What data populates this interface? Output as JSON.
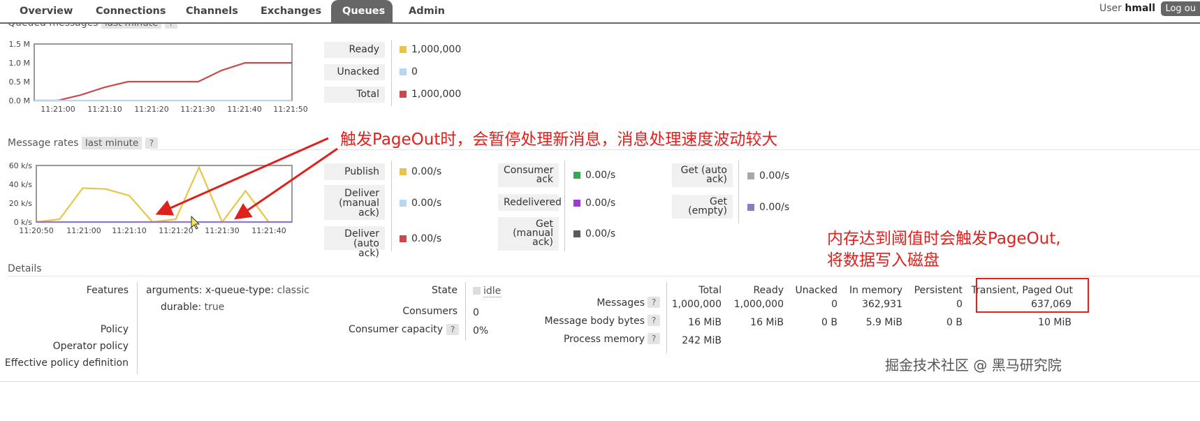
{
  "nav": {
    "tabs": [
      {
        "label": "Overview"
      },
      {
        "label": "Connections"
      },
      {
        "label": "Channels"
      },
      {
        "label": "Exchanges"
      },
      {
        "label": "Queues"
      },
      {
        "label": "Admin"
      }
    ],
    "active_tab": "Queues",
    "user_label": "User",
    "username": "hmall",
    "logout_label": "Log ou"
  },
  "queued_messages": {
    "title": "Queued messages",
    "range": "last minute",
    "help": "?",
    "legend": [
      {
        "label": "Ready",
        "value": "1,000,000",
        "color": "#e8c547"
      },
      {
        "label": "Unacked",
        "value": "0",
        "color": "#b5d7f2"
      },
      {
        "label": "Total",
        "value": "1,000,000",
        "color": "#c94a4a"
      }
    ]
  },
  "message_rates": {
    "title": "Message rates",
    "range": "last minute",
    "help": "?",
    "legend": [
      {
        "label": "Publish",
        "value": "0.00/s",
        "color": "#e8c547"
      },
      {
        "label": "Deliver (manual ack)",
        "value": "0.00/s",
        "color": "#b5d7f2"
      },
      {
        "label": "Deliver (auto ack)",
        "value": "0.00/s",
        "color": "#c94a4a"
      },
      {
        "label": "Consumer ack",
        "value": "0.00/s",
        "color": "#3aa655"
      },
      {
        "label": "Redelivered",
        "value": "0.00/s",
        "color": "#a03ad6"
      },
      {
        "label": "Get (manual ack)",
        "value": "0.00/s",
        "color": "#5a5a5a"
      },
      {
        "label": "Get (auto ack)",
        "value": "0.00/s",
        "color": "#a8a8a8"
      },
      {
        "label": "Get (empty)",
        "value": "0.00/s",
        "color": "#8a7ac8"
      }
    ]
  },
  "chart_data": [
    {
      "type": "line",
      "title": "Queued messages",
      "x": [
        "11:21:00",
        "11:21:10",
        "11:21:20",
        "11:21:30",
        "11:21:40",
        "11:21:50"
      ],
      "x_full": [
        "11:20:55",
        "11:21:00",
        "11:21:05",
        "11:21:10",
        "11:21:15",
        "11:21:20",
        "11:21:25",
        "11:21:30",
        "11:21:35",
        "11:21:40",
        "11:21:45",
        "11:21:50"
      ],
      "ylim": [
        0,
        1500000
      ],
      "yticks": [
        "0.0 M",
        "0.5 M",
        "1.0 M",
        "1.5 M"
      ],
      "series": [
        {
          "color": "#c94a4a",
          "values": [
            0,
            0,
            150000,
            350000,
            500000,
            500000,
            500000,
            500000,
            800000,
            1000000,
            1000000,
            1000000
          ]
        },
        {
          "color": "#b5d7f2",
          "values": [
            0,
            0,
            0,
            0,
            0,
            0,
            0,
            0,
            0,
            0,
            0,
            0
          ]
        }
      ]
    },
    {
      "type": "line",
      "title": "Message rates",
      "x": [
        "11:20:50",
        "11:21:00",
        "11:21:10",
        "11:21:20",
        "11:21:30",
        "11:21:40"
      ],
      "x_full": [
        "11:20:50",
        "11:20:55",
        "11:21:00",
        "11:21:05",
        "11:21:10",
        "11:21:15",
        "11:21:20",
        "11:21:25",
        "11:21:30",
        "11:21:35",
        "11:21:40",
        "11:21:45"
      ],
      "ylim": [
        0,
        60000
      ],
      "yticks": [
        "0 k/s",
        "20 k/s",
        "40 k/s",
        "60 k/s"
      ],
      "series": [
        {
          "color": "#e8c547",
          "values": [
            0,
            3000,
            36000,
            35000,
            28000,
            0,
            3000,
            58000,
            0,
            33000,
            0,
            0
          ]
        },
        {
          "color": "#8a7ac8",
          "values": [
            0,
            0,
            0,
            0,
            0,
            0,
            0,
            0,
            0,
            0,
            0,
            0
          ]
        }
      ]
    }
  ],
  "annotations": {
    "pageout_note": "触发PageOut时，会暂停处理新消息，消息处理速度波动较大",
    "threshold_line1": "内存达到阈值时会触发PageOut,",
    "threshold_line2": "将数据写入磁盘"
  },
  "details": {
    "title": "Details",
    "features_label": "Features",
    "arguments_key": "arguments:",
    "x_queue_type_key": "x-queue-type:",
    "x_queue_type_val": "classic",
    "durable_key": "durable:",
    "durable_val": "true",
    "policy_label": "Policy",
    "operator_policy_label": "Operator policy",
    "effective_policy_label": "Effective policy definition",
    "state_label": "State",
    "state_value": "idle",
    "consumers_label": "Consumers",
    "consumers_value": "0",
    "consumer_capacity_label": "Consumer capacity",
    "consumer_capacity_value": "0%",
    "table": {
      "headers": [
        "Total",
        "Ready",
        "Unacked",
        "In memory",
        "Persistent",
        "Transient, Paged Out"
      ],
      "rows": [
        {
          "label": "Messages",
          "values": [
            "1,000,000",
            "1,000,000",
            "0",
            "362,931",
            "0",
            "637,069"
          ]
        },
        {
          "label": "Message body bytes",
          "values": [
            "16 MiB",
            "16 MiB",
            "0 B",
            "5.9 MiB",
            "0 B",
            "10 MiB"
          ]
        },
        {
          "label": "Process memory",
          "values": [
            "242 MiB",
            "",
            "",
            "",
            "",
            ""
          ]
        }
      ]
    }
  },
  "watermark": "掘金技术社区 @ 黑马研究院"
}
